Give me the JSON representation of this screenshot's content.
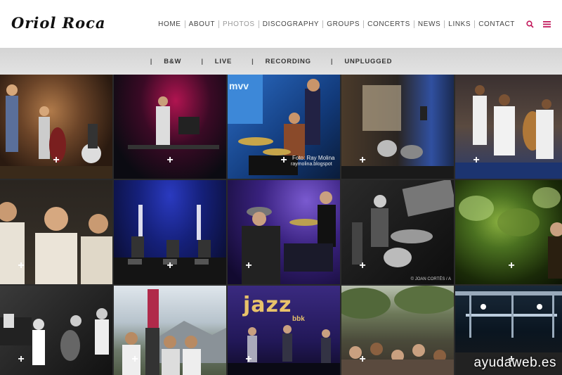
{
  "header": {
    "logo": "Oriol Roca",
    "nav": [
      {
        "label": "HOME",
        "active": false
      },
      {
        "label": "ABOUT",
        "active": false
      },
      {
        "label": "PHOTOS",
        "active": true
      },
      {
        "label": "DISCOGRAPHY",
        "active": false
      },
      {
        "label": "GROUPS",
        "active": false
      },
      {
        "label": "CONCERTS",
        "active": false
      },
      {
        "label": "NEWS",
        "active": false
      },
      {
        "label": "LINKS",
        "active": false
      },
      {
        "label": "CONTACT",
        "active": false
      }
    ],
    "icons": [
      "search-icon",
      "menu-icon"
    ],
    "accent": "#c2185b"
  },
  "filters": [
    "B&W",
    "LIVE",
    "RECORDING",
    "UNPLUGGED"
  ],
  "filter_separator": "|",
  "tiles": {
    "plus": "+",
    "t3_text": "mvv",
    "t3_caption": "Foto: Ray Molina",
    "t3_caption2": "raymolina.blogspot",
    "t13_title": "jazz",
    "t13_sub": "bbk",
    "t10_caption": "© JOAN CORTÉS / A"
  },
  "watermark": "ayudaweb.es"
}
